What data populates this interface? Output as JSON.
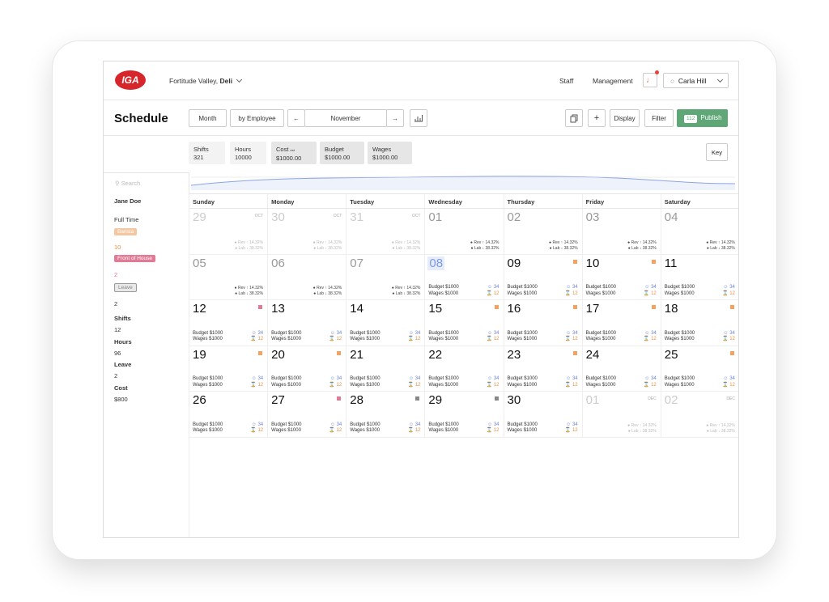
{
  "header": {
    "logo": "IGA",
    "store": "Fortitude Valley,",
    "store_dept": "Deli",
    "staff": "Staff",
    "management": "Management",
    "user": "Carla Hill"
  },
  "toolbar": {
    "title": "Schedule",
    "view": "Month",
    "group": "by Employee",
    "period": "November",
    "prev": "←",
    "next": "→",
    "display": "Display",
    "filter": "Filter",
    "publish": "Publish",
    "publish_count": "112",
    "add": "+"
  },
  "stats": {
    "shifts_label": "Shifts",
    "shifts": "321",
    "hours_label": "Hours",
    "hours": "10000",
    "cost_label": "Cost",
    "cost_tag": "est",
    "cost": "$1000.00",
    "budget_label": "Budget",
    "budget": "$1000.00",
    "wages_label": "Wages",
    "wages": "$1000.00",
    "key": "Key"
  },
  "search": {
    "placeholder": "Search"
  },
  "employee": {
    "name": "Jane Doe",
    "type": "Full Time",
    "tag1": "Barista",
    "tag1_count": "10",
    "tag2": "Front of House",
    "tag2_count": "2",
    "tag3": "Leave",
    "tag3_count": "2",
    "shifts_label": "Shifts",
    "shifts": "12",
    "hours_label": "Hours",
    "hours": "96",
    "leave_label": "Leave",
    "leave": "2",
    "cost_label": "Cost",
    "cost": "$800"
  },
  "days": [
    "Sunday",
    "Monday",
    "Tuesday",
    "Wednesday",
    "Thursday",
    "Friday",
    "Saturday"
  ],
  "labels": {
    "rev": "Rev",
    "lab": "Lab",
    "rev_val": "14.32%",
    "lab_val": "38.32%",
    "budget": "Budget",
    "wages": "Wages",
    "budget_val": "$1000",
    "wages_val": "$1000",
    "staff_count": "34",
    "hours_count": "12"
  },
  "colors": {
    "accent": "#5fa777",
    "people": "#6b84d6",
    "hours": "#e88f3f",
    "flag_pink": "#e07a95",
    "flag_orange": "#f4a261",
    "flag_grey": "#888888"
  },
  "weeks": [
    [
      {
        "n": "29",
        "mo": "OCT",
        "k": "faint",
        "m": "rl"
      },
      {
        "n": "30",
        "mo": "OCT",
        "k": "faint",
        "m": "rl"
      },
      {
        "n": "31",
        "mo": "OCT",
        "k": "faint",
        "m": "rl"
      },
      {
        "n": "01",
        "k": "dim",
        "m": "rl"
      },
      {
        "n": "02",
        "k": "dim",
        "m": "rl"
      },
      {
        "n": "03",
        "k": "dim",
        "m": "rl"
      },
      {
        "n": "04",
        "k": "dim",
        "m": "rl"
      }
    ],
    [
      {
        "n": "05",
        "k": "dim",
        "m": "rl"
      },
      {
        "n": "06",
        "k": "dim",
        "m": "rl"
      },
      {
        "n": "07",
        "k": "dim",
        "m": "rl"
      },
      {
        "n": "08",
        "k": "today",
        "m": "bw"
      },
      {
        "n": "09",
        "m": "bw",
        "f": "orange"
      },
      {
        "n": "10",
        "m": "bw",
        "f": "orange"
      },
      {
        "n": "11",
        "m": "bw"
      }
    ],
    [
      {
        "n": "12",
        "m": "bw",
        "f": "pink"
      },
      {
        "n": "13",
        "m": "bw"
      },
      {
        "n": "14",
        "m": "bw"
      },
      {
        "n": "15",
        "m": "bw",
        "f": "orange"
      },
      {
        "n": "16",
        "m": "bw",
        "f": "orange"
      },
      {
        "n": "17",
        "m": "bw",
        "f": "orange"
      },
      {
        "n": "18",
        "m": "bw",
        "f": "orange"
      }
    ],
    [
      {
        "n": "19",
        "m": "bw",
        "f": "orange"
      },
      {
        "n": "20",
        "m": "bw",
        "f": "orange"
      },
      {
        "n": "21",
        "m": "bw"
      },
      {
        "n": "22",
        "m": "bw"
      },
      {
        "n": "23",
        "m": "bw",
        "f": "orange"
      },
      {
        "n": "24",
        "m": "bw"
      },
      {
        "n": "25",
        "m": "bw",
        "f": "orange"
      }
    ],
    [
      {
        "n": "26",
        "m": "bw"
      },
      {
        "n": "27",
        "m": "bw",
        "f": "pink"
      },
      {
        "n": "28",
        "m": "bw",
        "f": "grey"
      },
      {
        "n": "29",
        "m": "bw",
        "f": "grey"
      },
      {
        "n": "30",
        "m": "bw"
      },
      {
        "n": "01",
        "mo": "DEC",
        "k": "faint",
        "m": "rl"
      },
      {
        "n": "02",
        "mo": "DEC",
        "k": "faint",
        "m": "rl"
      }
    ]
  ]
}
